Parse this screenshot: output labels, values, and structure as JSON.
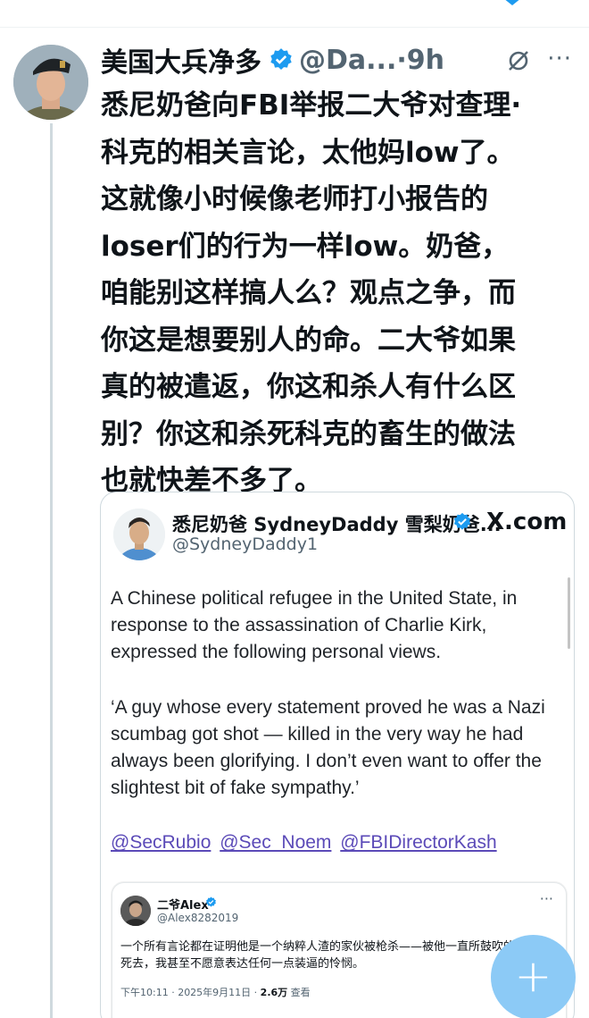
{
  "post": {
    "author_name": "美国大兵净多",
    "handle": "@Da...",
    "time": "·9h",
    "more": "···",
    "text": "悉尼奶爸向FBI举报二大爷对查理·\n科克的相关言论，太他妈low了。\n这就像小时候像老师打小报告的\nloser们的行为一样low。奶爸，\n咱能别这样搞人么？观点之争，而\n你这是想要别人的命。二大爷如果\n真的被遣返，你这和杀人有什么区\n别？你这和杀死科克的畜生的做法\n也就快差不多了。"
  },
  "quote": {
    "author_name": "悉尼奶爸 SydneyDaddy 雪梨奶爸...",
    "handle": "@SydneyDaddy1",
    "source": ".com",
    "source_mark": "X",
    "para1": "A Chinese political refugee in the United State, in response to the assassination of Charlie Kirk, expressed the following personal views.",
    "para2": "‘A guy whose every statement proved he was a Nazi scumbag got shot — killed in the very way he had always been glorifying. I don’t even want to offer the slightest bit of fake sympathy.’",
    "mentions": [
      "@SecRubio",
      "@Sec_Noem",
      "@FBIDirectorKash"
    ]
  },
  "embedded": {
    "author_name": "二爷Alex",
    "handle": "@Alex8282019",
    "more": "···",
    "text": "一个所有言论都在证明他是一个纳粹人渣的家伙被枪杀——被他一直所鼓吹的方式死去，我甚至不愿意表达任何一点装逼的怜悯。",
    "timestamp": "下午10:11 · 2025年9月11日 · ",
    "views_count": "2.6万",
    "views_label": " 查看"
  },
  "compose": {
    "label": "+"
  },
  "colors": {
    "accent": "#1d9bf0",
    "fab": "#8ccaf6",
    "link": "#5b4ab8",
    "text": "#0f1419",
    "muted": "#536471"
  }
}
